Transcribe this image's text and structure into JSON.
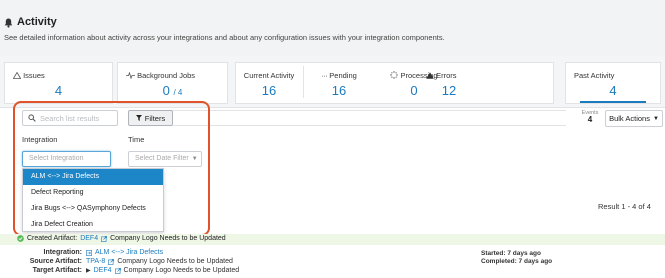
{
  "header": {
    "title": "Activity",
    "subtitle": "See detailed information about activity across your integrations and about any configuration issues with your integration components."
  },
  "stats": {
    "issues": {
      "label": "Issues",
      "value": "4"
    },
    "background_jobs": {
      "label": "Background Jobs",
      "value": "0",
      "total": "/ 4"
    },
    "current_activity": {
      "label": "Current Activity",
      "value": "16"
    },
    "pending": {
      "label": "Pending",
      "value": "16"
    },
    "processing": {
      "label": "Processing",
      "value": "0"
    },
    "errors": {
      "label": "Errors",
      "value": "12"
    },
    "past_activity": {
      "label": "Past Activity",
      "value": "4"
    }
  },
  "toolbar": {
    "search_placeholder": "Search list results",
    "filters_label": "Filters",
    "events_label": "Events",
    "events_count": "4",
    "bulk_actions_label": "Bulk Actions"
  },
  "filters": {
    "integration_label": "Integration",
    "time_label": "Time",
    "integration_placeholder": "Select Integration",
    "date_placeholder": "Select Date Filter",
    "integration_options": [
      "ALM <--> Jira Defects",
      "Defect Reporting",
      "Jira Bugs <--> QASymphony Defects",
      "Jira Defect Creation"
    ],
    "selected_index": 0
  },
  "results": {
    "count_text": "Result 1 - 4 of 4"
  },
  "activity_item": {
    "created_prefix": "Created Artifact:",
    "created_id": "DEF4",
    "created_title": "Company Logo Needs to be Updated",
    "integration_label": "Integration:",
    "integration_value": "ALM <--> Jira Defects",
    "source_label": "Source Artifact:",
    "source_id": "TPA-8",
    "source_title": "Company Logo Needs to be Updated",
    "target_label": "Target Artifact:",
    "target_id": "DEF4",
    "target_title": "Company Logo Needs to be Updated",
    "started_text": "Started: 7 days ago",
    "completed_text": "Completed: 7 days ago"
  },
  "colors": {
    "accent": "#1a7bbf",
    "selected_option_bg": "#1d86c8",
    "highlight_outline": "#e0532a",
    "success_banner": "#eef6e6",
    "success_icon": "#5cb85c"
  },
  "icons": {
    "title_icon": "bell-icon",
    "issues_icon": "warning-icon",
    "background_jobs_icon": "pulse-icon",
    "pending_icon": "ellipsis-icon",
    "processing_icon": "spinner-icon",
    "errors_icon": "error-triangle-icon",
    "search_icon": "search-icon",
    "filters_icon": "filter-icon",
    "created_icon": "check-circle-icon",
    "link_icon": "external-link-icon"
  }
}
